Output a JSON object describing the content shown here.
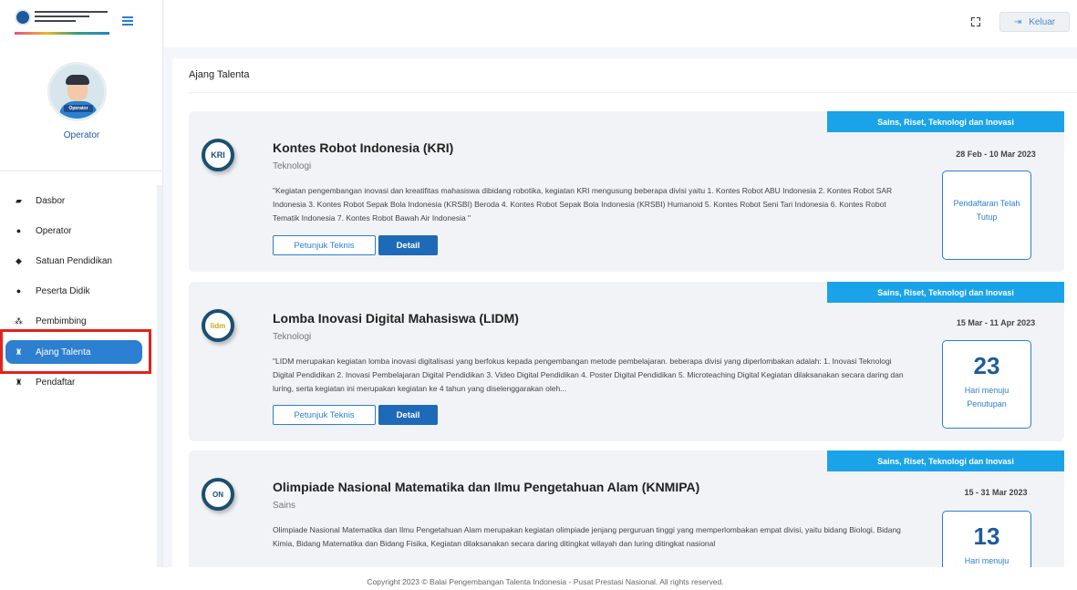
{
  "sidebar": {
    "role_label": "Operator",
    "avatar_badge": "Operator",
    "items": [
      {
        "label": "Dasbor",
        "icon": "dashboard-icon"
      },
      {
        "label": "Operator",
        "icon": "user-icon"
      },
      {
        "label": "Satuan Pendidikan",
        "icon": "graduation-cap-icon"
      },
      {
        "label": "Peserta Didik",
        "icon": "user-icon"
      },
      {
        "label": "Pembimbing",
        "icon": "users-icon"
      },
      {
        "label": "Ajang Talenta",
        "icon": "trophy-icon",
        "active": true
      },
      {
        "label": "Pendaftar",
        "icon": "trophy-icon"
      }
    ]
  },
  "topbar": {
    "logout_label": "Keluar"
  },
  "main": {
    "page_title": "Ajang Talenta",
    "cards": [
      {
        "tag": "Sains, Riset, Teknologi dan Inovasi",
        "logo": "KRI",
        "title": "Kontes Robot Indonesia (KRI)",
        "category": "Teknologi",
        "description": "\"Kegiatan pengembangan inovasi dan kreatifitas mahasiswa dibidang robotika, kegiatan KRI mengusung beberapa divisi yaitu 1. Kontes Robot ABU Indonesia 2. Kontes Robot SAR Indonesia 3. Kontes Robot Sepak Bola Indonesia (KRSBI) Beroda 4. Kontes Robot Sepak Bola Indonesia (KRSBI) Humanoid 5. Kontes Robot Seni Tari Indonesia 6. Kontes Robot Tematik Indonesia 7. Kontes Robot Bawah Air Indonesia \"",
        "btn_guide": "Petunjuk Teknis",
        "btn_detail": "Detail",
        "date": "28 Feb - 10 Mar 2023",
        "count": "",
        "count_label": "Pendaftaran Telah Tutup"
      },
      {
        "tag": "Sains, Riset, Teknologi dan Inovasi",
        "logo": "lidm",
        "title": "Lomba Inovasi Digital Mahasiswa (LIDM)",
        "category": "Teknologi",
        "description": "\"LIDM merupakan kegiatan lomba inovasi digitalisasi yang berfokus kepada pengembangan metode pembelajaran. beberapa divisi yang diperlombakan adalah: 1. Inovasi Teknologi Digital Pendidikan 2. Inovasi Pembelajaran Digital Pendidikan 3. Video Digital Pendidikan 4. Poster Digital Pendidikan 5. Microteaching Digital Kegiatan dilaksanakan secara daring dan luring, serta kegiatan ini merupakan kegiatan ke 4 tahun yang diselenggarakan oleh...",
        "btn_guide": "Petunjuk Teknis",
        "btn_detail": "Detail",
        "date": "15 Mar - 11 Apr 2023",
        "count": "23",
        "count_label": "Hari menuju Penutupan"
      },
      {
        "tag": "Sains, Riset, Teknologi dan Inovasi",
        "logo": "ON",
        "title": "Olimpiade Nasional Matematika dan Ilmu Pengetahuan Alam (KNMIPA)",
        "category": "Sains",
        "description": "Olimpiade Nasional Matematika dan Ilmu Pengetahuan Alam merupakan kegiatan olimpiade jenjang perguruan tinggi yang memperlombakan empat divisi, yaitu bidang Biologi, Bidang Kimia, Bidang Matematika dan Bidang Fisika, Kegiatan dilaksanakan secara daring ditingkat wilayah dan luring ditingkat nasional",
        "date": "15 - 31 Mar 2023",
        "count": "13",
        "count_label": "Hari menuju"
      }
    ]
  },
  "footer": {
    "copyright": "Copyright 2023 © Balai Pengembangan Talenta Indonesia - Pusat Prestasi Nasional. All rights reserved."
  }
}
